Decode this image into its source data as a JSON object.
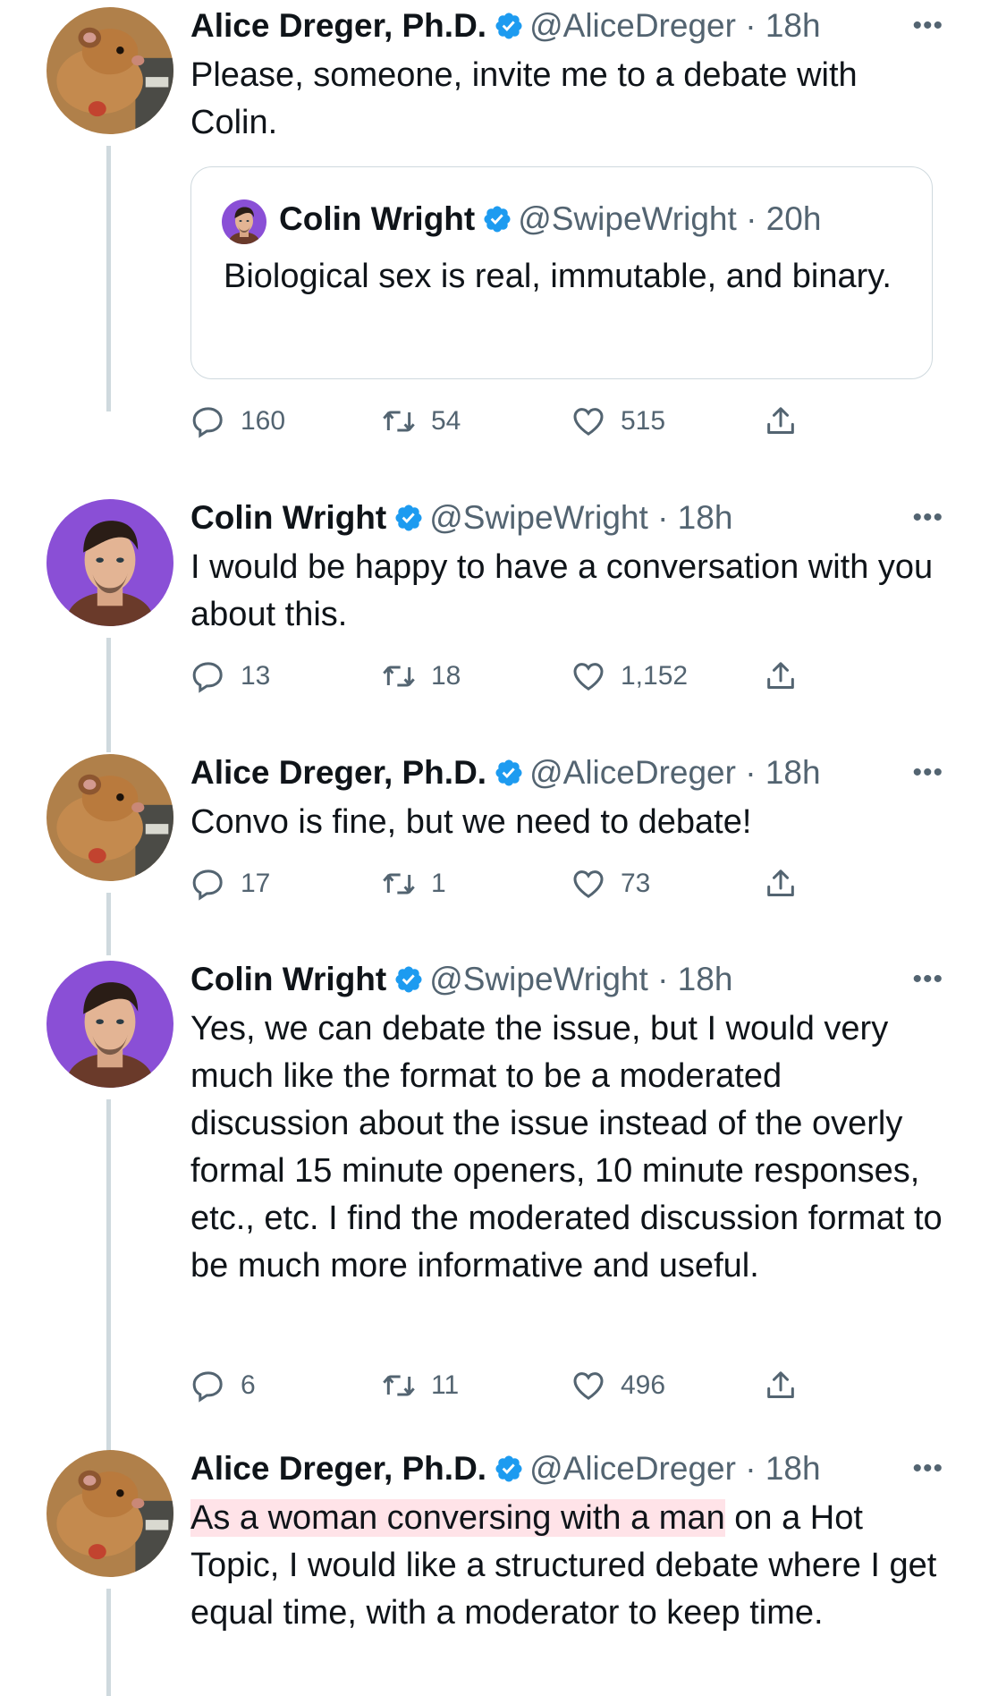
{
  "colors": {
    "verified": "#1d9bf0",
    "handle": "#536471",
    "line": "#cfd9de",
    "avatar_purple": "#8a4fd6"
  },
  "tweets": [
    {
      "name": "Alice Dreger, Ph.D.",
      "handle": "@AliceDreger",
      "time": "· 18h",
      "text": "Please, someone, invite me to a debate with Colin.",
      "quote": {
        "name": "Colin Wright",
        "handle": "@SwipeWright",
        "time": "· 20h",
        "text": "Biological sex is real, immutable, and binary."
      },
      "replies": "160",
      "retweets": "54",
      "likes": "515"
    },
    {
      "name": "Colin Wright",
      "handle": "@SwipeWright",
      "time": "· 18h",
      "text": "I would be happy to have a conversation with you about this.",
      "replies": "13",
      "retweets": "18",
      "likes": "1,152"
    },
    {
      "name": "Alice Dreger, Ph.D.",
      "handle": "@AliceDreger",
      "time": "· 18h",
      "text": "Convo is fine, but we need to debate!",
      "replies": "17",
      "retweets": "1",
      "likes": "73"
    },
    {
      "name": "Colin Wright",
      "handle": "@SwipeWright",
      "time": "· 18h",
      "text": "Yes, we can debate the issue, but I would very much like the format to be a moderated discussion about the issue instead of the overly formal 15 minute openers, 10 minute responses, etc., etc. I find the moderated discussion format to be much more informative and useful.",
      "replies": "6",
      "retweets": "11",
      "likes": "496"
    },
    {
      "name": "Alice Dreger, Ph.D.",
      "handle": "@AliceDreger",
      "time": "· 18h",
      "text_highlight": "As a woman conversing with a man",
      "text_rest": " on a Hot Topic, I would like a structured debate where I get equal time, with a moderator to keep time."
    }
  ],
  "more_glyph": "•••"
}
